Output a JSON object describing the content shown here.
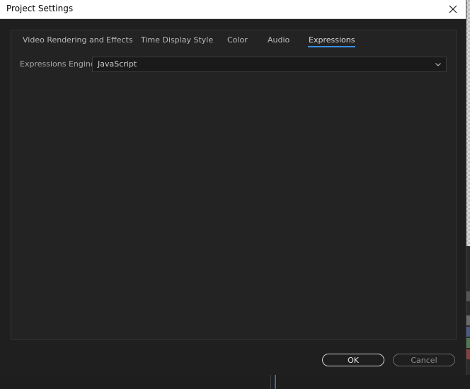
{
  "window": {
    "title": "Project Settings",
    "close_icon": "close-icon"
  },
  "tabs": [
    {
      "label": "Video Rendering and Effects",
      "active": false
    },
    {
      "label": "Time Display Style",
      "active": false
    },
    {
      "label": "Color",
      "active": false
    },
    {
      "label": "Audio",
      "active": false
    },
    {
      "label": "Expressions",
      "active": true
    }
  ],
  "expressions": {
    "engine_label": "Expressions Engine:",
    "engine_value": "JavaScript",
    "dropdown_icon": "chevron-down-icon"
  },
  "buttons": {
    "ok": "OK",
    "cancel": "Cancel"
  },
  "colors": {
    "accent": "#3a8ee6",
    "dialog_bg": "#1f1f1f",
    "titlebar_bg": "#ffffff"
  }
}
